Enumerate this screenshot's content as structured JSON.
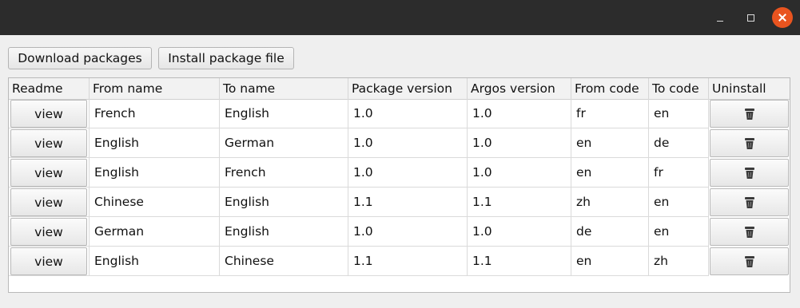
{
  "window": {
    "controls": [
      "minimize-icon",
      "maximize-icon",
      "close-icon"
    ],
    "colors": {
      "titlebar": "#2c2c2c",
      "close_button": "#e9541f"
    }
  },
  "toolbar": {
    "download_label": "Download packages",
    "install_label": "Install package file"
  },
  "table": {
    "columns": [
      "Readme",
      "From name",
      "To name",
      "Package version",
      "Argos version",
      "From code",
      "To code",
      "Uninstall"
    ],
    "view_label": "view",
    "uninstall_icon": "trash-icon",
    "rows": [
      {
        "from_name": "French",
        "to_name": "English",
        "package_version": "1.0",
        "argos_version": "1.0",
        "from_code": "fr",
        "to_code": "en"
      },
      {
        "from_name": "English",
        "to_name": "German",
        "package_version": "1.0",
        "argos_version": "1.0",
        "from_code": "en",
        "to_code": "de"
      },
      {
        "from_name": "English",
        "to_name": "French",
        "package_version": "1.0",
        "argos_version": "1.0",
        "from_code": "en",
        "to_code": "fr"
      },
      {
        "from_name": "Chinese",
        "to_name": "English",
        "package_version": "1.1",
        "argos_version": "1.1",
        "from_code": "zh",
        "to_code": "en"
      },
      {
        "from_name": "German",
        "to_name": "English",
        "package_version": "1.0",
        "argos_version": "1.0",
        "from_code": "de",
        "to_code": "en"
      },
      {
        "from_name": "English",
        "to_name": "Chinese",
        "package_version": "1.1",
        "argos_version": "1.1",
        "from_code": "en",
        "to_code": "zh"
      }
    ]
  }
}
